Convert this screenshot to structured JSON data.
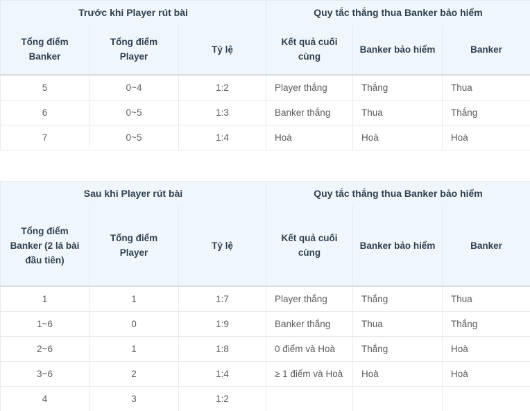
{
  "tables": [
    {
      "id": "before-player-draws",
      "group_headers": [
        {
          "label": "Trước khi Player rút bài",
          "span": 3
        },
        {
          "label": "Quy tắc thắng thua Banker bảo hiểm",
          "span": 3
        }
      ],
      "columns": [
        "Tổng điểm Banker",
        "Tổng điểm Player",
        "Tỷ lệ",
        "Kết quả cuối cùng",
        "Banker bảo hiểm",
        "Banker"
      ],
      "rows": [
        [
          "5",
          "0~4",
          "1:2",
          "Player thắng",
          "Thắng",
          "Thua"
        ],
        [
          "6",
          "0~5",
          "1:3",
          "Banker thắng",
          "Thua",
          "Thắng"
        ],
        [
          "7",
          "0~5",
          "1:4",
          "Hoà",
          "Hoà",
          "Hoà"
        ]
      ]
    },
    {
      "id": "after-player-draws",
      "group_headers": [
        {
          "label": "Sau khi Player rút bài",
          "span": 3
        },
        {
          "label": "Quy tắc thắng thua Banker bảo hiểm",
          "span": 3
        }
      ],
      "columns": [
        "Tổng điểm Banker (2 lá bài đầu tiên)",
        "Tổng điểm Player",
        "Tỷ lệ",
        "Kết quả cuối cùng",
        "Banker bảo hiểm",
        "Banker"
      ],
      "rows": [
        [
          "1",
          "1",
          "1:7",
          "Player thắng",
          "Thắng",
          "Thua"
        ],
        [
          "1~6",
          "0",
          "1:9",
          "Banker thắng",
          "Thua",
          "Thắng"
        ],
        [
          "2~6",
          "1",
          "1:8",
          "0 điểm và Hoà",
          "Thắng",
          "Hoà"
        ],
        [
          "3~6",
          "2",
          "1:4",
          "≥ 1 điểm và Hoà",
          "Hoà",
          "Hoà"
        ],
        [
          "4",
          "3",
          "1:2",
          "",
          "",
          ""
        ]
      ]
    }
  ],
  "colors": {
    "header_bg": "#eff7fd",
    "header_text": "#31404e",
    "body_text": "#5a5a5a",
    "border": "#e8eaec",
    "header_rule": "#d6dde3"
  }
}
